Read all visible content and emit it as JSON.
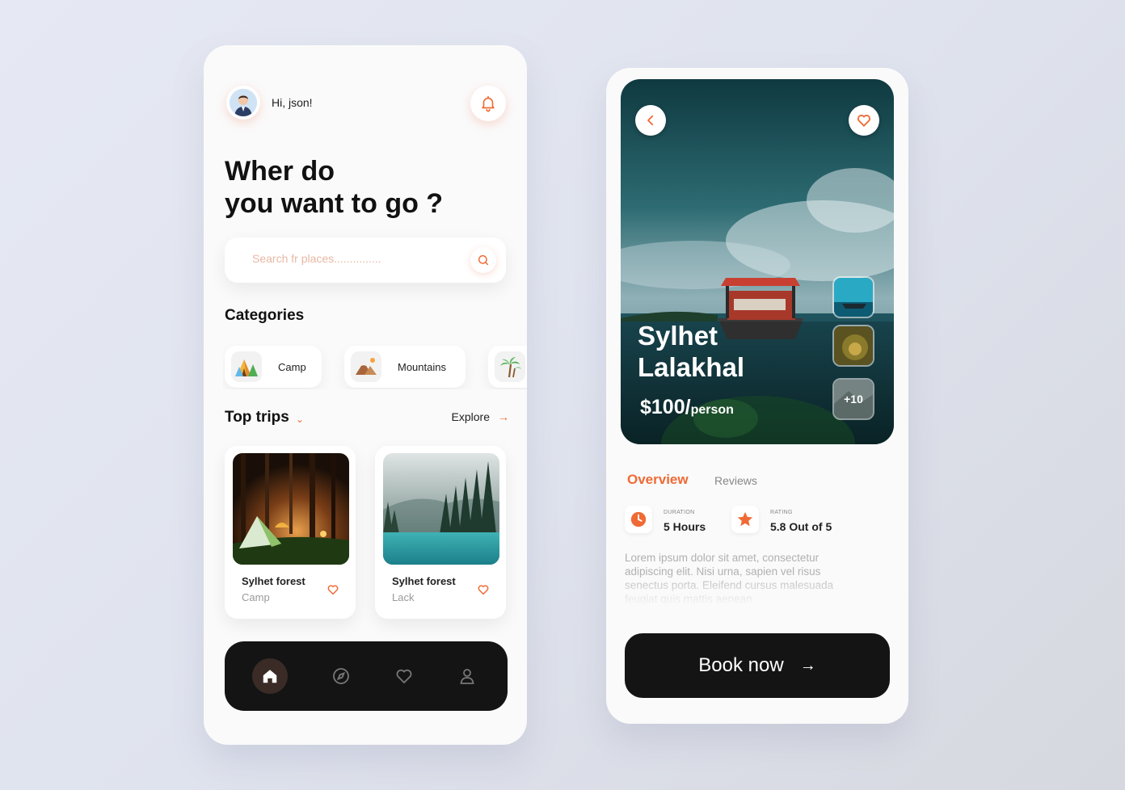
{
  "home": {
    "greeting": "Hi, json!",
    "headline_line1": "Wher do",
    "headline_line2": "you want to go ?",
    "search": {
      "placeholder": "Search fr places..............."
    },
    "categories_title": "Categories",
    "categories": [
      {
        "label": "Camp",
        "icon": "camp-icon"
      },
      {
        "label": "Mountains",
        "icon": "mountains-icon"
      },
      {
        "label": "",
        "icon": "palm-tree-icon"
      }
    ],
    "top_trips_title": "Top trips",
    "explore_label": "Explore",
    "trips": [
      {
        "title": "Sylhet forest",
        "subtitle": "Camp"
      },
      {
        "title": "Sylhet forest",
        "subtitle": "Lack"
      }
    ],
    "nav": [
      "home-icon",
      "compass-icon",
      "heart-icon",
      "profile-icon"
    ]
  },
  "detail": {
    "place_line1": "Sylhet",
    "place_line2": "Lalakhal",
    "price": "$100/",
    "price_unit": "person",
    "more_photos": "+10",
    "tabs": {
      "overview": "Overview",
      "reviews": "Reviews"
    },
    "duration": {
      "label": "DURATION",
      "value": "5 Hours"
    },
    "rating": {
      "label": "RATING",
      "value": "5.8 Out of 5"
    },
    "description": "Lorem ipsum dolor sit amet, consectetur adipiscing elit. Nisi urna, sapien vel risus senectus porta. Eleifend cursus malesuada feugiat quis mattis aenean",
    "book_label": "Book now"
  },
  "colors": {
    "accent": "#f06a35",
    "dark": "#141414",
    "background": "#fafafa"
  }
}
